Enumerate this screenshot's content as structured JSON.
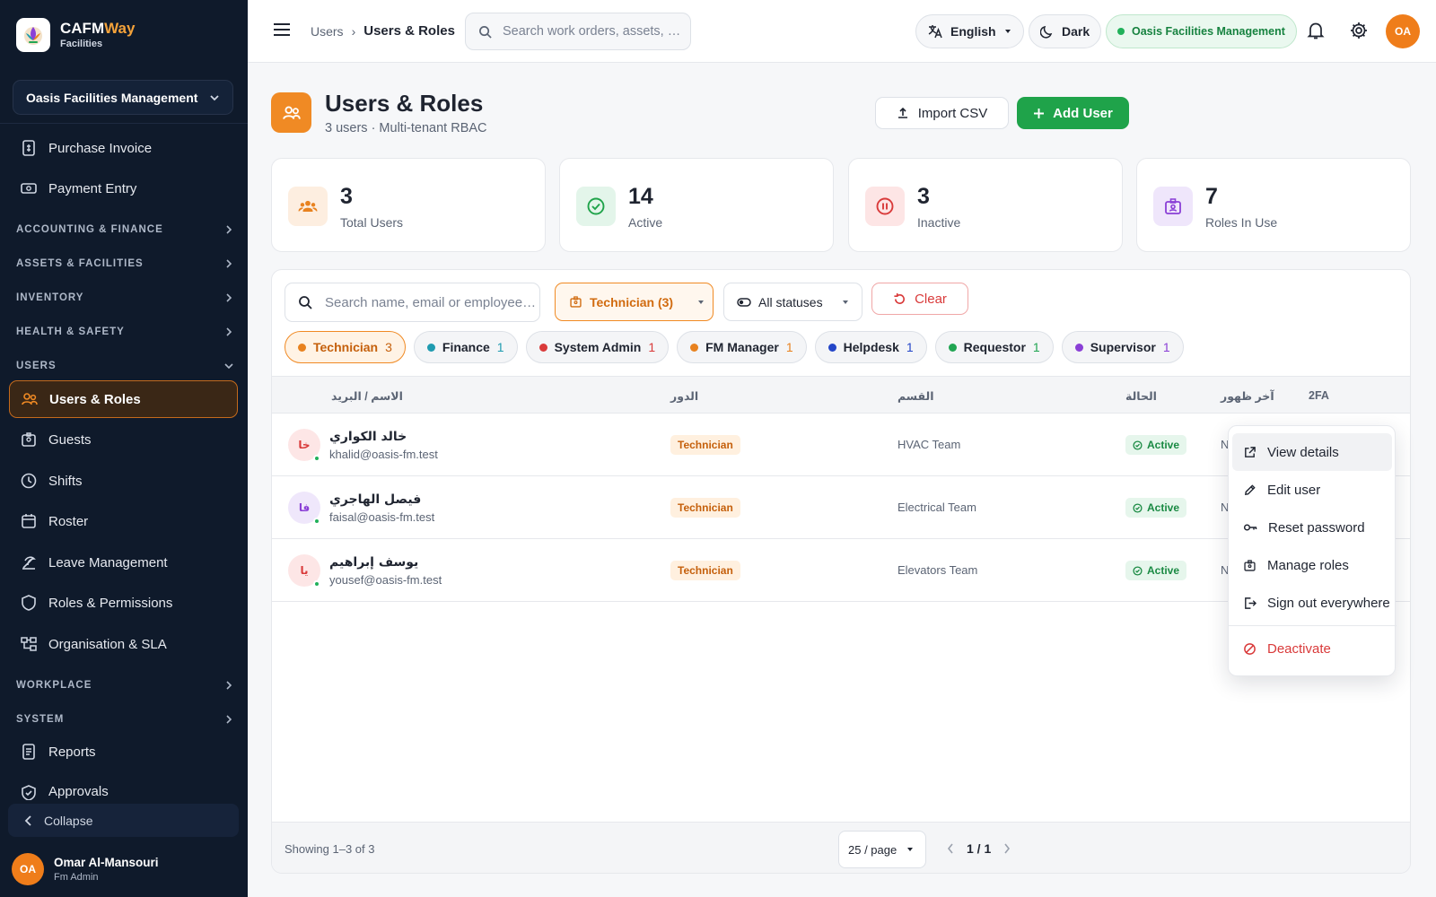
{
  "brand": {
    "name_a": "CAFM",
    "name_b": "Way",
    "sub": "Facilities"
  },
  "tenant_select": "Oasis Facilities Management",
  "nav": {
    "purchase_invoice": "Purchase Invoice",
    "payment_entry": "Payment Entry",
    "sec_accounting": "ACCOUNTING & FINANCE",
    "sec_assets": "ASSETS & FACILITIES",
    "sec_inventory": "INVENTORY",
    "sec_health": "HEALTH & SAFETY",
    "sec_users": "USERS",
    "users_roles": "Users & Roles",
    "guests": "Guests",
    "shifts": "Shifts",
    "roster": "Roster",
    "leave": "Leave Management",
    "roles_perms": "Roles & Permissions",
    "org_sla": "Organisation & SLA",
    "sec_workplace": "WORKPLACE",
    "sec_system": "SYSTEM",
    "reports": "Reports",
    "approvals": "Approvals",
    "collapse": "Collapse"
  },
  "current_user": {
    "initials": "OA",
    "name": "Omar Al-Mansouri",
    "role": "Fm Admin"
  },
  "topbar": {
    "breadcrumb_parent": "Users",
    "breadcrumb_sep": "›",
    "breadcrumb_current": "Users & Roles",
    "search_placeholder": "Search work orders, assets, …",
    "language": "English",
    "theme": "Dark",
    "tenant": "Oasis Facilities Management",
    "avatar": "OA"
  },
  "page": {
    "title": "Users & Roles",
    "subtitle": "3 users · Multi-tenant RBAC",
    "import_label": "Import CSV",
    "add_label": "Add User"
  },
  "stats": [
    {
      "value": "3",
      "label": "Total Users"
    },
    {
      "value": "14",
      "label": "Active"
    },
    {
      "value": "3",
      "label": "Inactive"
    },
    {
      "value": "7",
      "label": "Roles In Use"
    }
  ],
  "filters": {
    "search_placeholder": "Search name, email or employee…",
    "role": "Technician (3)",
    "status": "All statuses",
    "clear": "Clear"
  },
  "role_chips": [
    {
      "label": "Technician",
      "count": "3",
      "color": "#e8821f"
    },
    {
      "label": "Finance",
      "count": "1",
      "color": "#1f9bb0"
    },
    {
      "label": "System Admin",
      "count": "1",
      "color": "#d93a3a"
    },
    {
      "label": "FM Manager",
      "count": "1",
      "color": "#e8821f"
    },
    {
      "label": "Helpdesk",
      "count": "1",
      "color": "#2446c8"
    },
    {
      "label": "Requestor",
      "count": "1",
      "color": "#21a552"
    },
    {
      "label": "Supervisor",
      "count": "1",
      "color": "#8a3fd6"
    }
  ],
  "table": {
    "headers": {
      "name": "الاسم / البريد",
      "role": "الدور",
      "dept": "القسم",
      "status": "الحالة",
      "last_seen": "آخر ظهور",
      "twofa": "2FA"
    },
    "rows": [
      {
        "initials": "خا",
        "name": "خالد الكواري",
        "email": "khalid@oasis-fm.test",
        "role": "Technician",
        "dept": "HVAC Team",
        "status": "Active",
        "last_seen": "N",
        "avatar_bg": "#fde6e6",
        "avatar_fg": "#d93a3a"
      },
      {
        "initials": "فا",
        "name": "فيصل الهاجري",
        "email": "faisal@oasis-fm.test",
        "role": "Technician",
        "dept": "Electrical Team",
        "status": "Active",
        "last_seen": "N",
        "avatar_bg": "#efe7fb",
        "avatar_fg": "#8a3fd6"
      },
      {
        "initials": "يا",
        "name": "يوسف إبراهيم",
        "email": "yousef@oasis-fm.test",
        "role": "Technician",
        "dept": "Elevators Team",
        "status": "Active",
        "last_seen": "N",
        "avatar_bg": "#fde6e6",
        "avatar_fg": "#d93a3a"
      }
    ],
    "showing": "Showing 1–3 of 3",
    "per_page": "25 / page",
    "page": "1 / 1"
  },
  "menu": {
    "view": "View details",
    "edit": "Edit user",
    "reset": "Reset password",
    "roles": "Manage roles",
    "signout": "Sign out everywhere",
    "deactivate": "Deactivate"
  },
  "colors": {
    "accent": "#f08a24",
    "primary_green": "#1fa34a",
    "sidebar_bg": "#0f1a2b",
    "danger": "#d93a3a"
  }
}
